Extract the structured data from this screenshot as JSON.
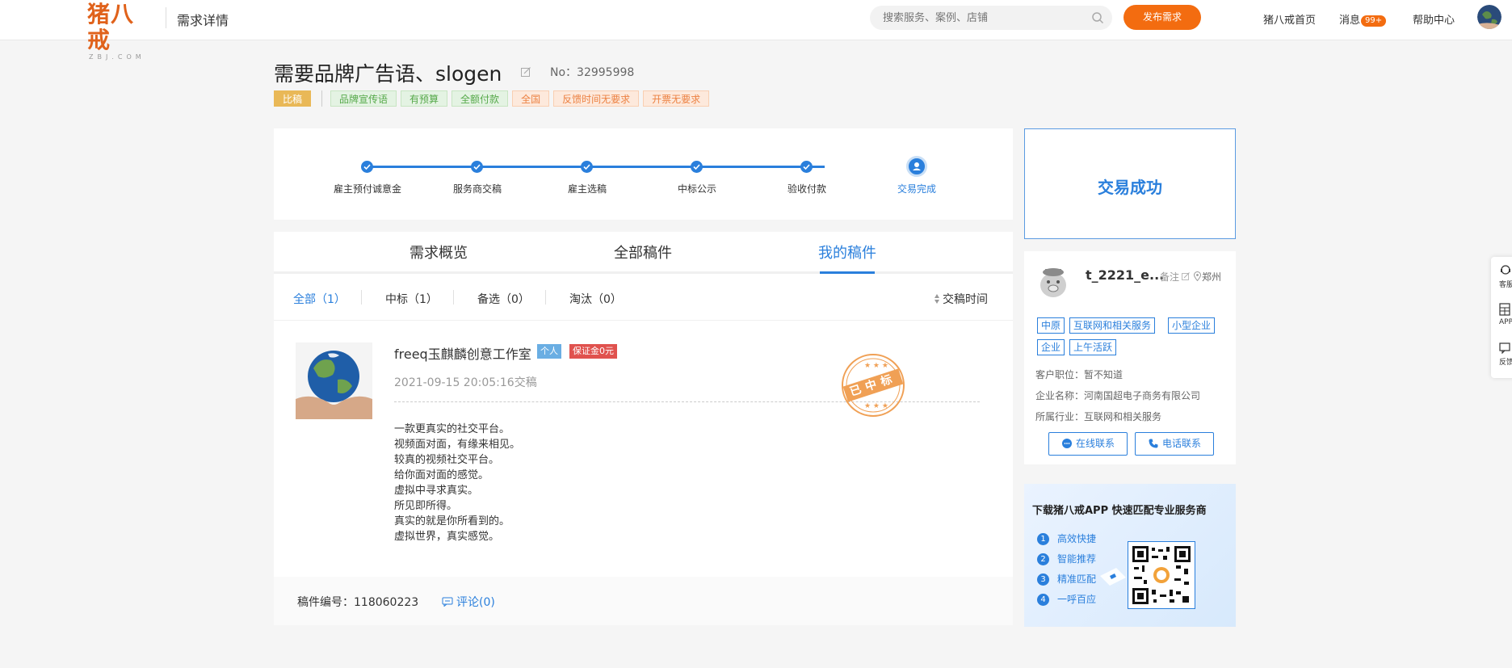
{
  "header": {
    "logo_text": "猪八戒",
    "logo_sub": "ZBJ.COM",
    "page_name": "需求详情",
    "search_placeholder": "搜索服务、案例、店铺",
    "publish_label": "发布需求",
    "nav": {
      "home": "猪八戒首页",
      "messages": "消息",
      "messages_badge": "99+",
      "help": "帮助中心"
    }
  },
  "requirement": {
    "title": "需要品牌广告语、slogen",
    "number": "No：32995998",
    "type_tag": "比稿",
    "tags_green": [
      "品牌宣传语",
      "有预算",
      "全额付款"
    ],
    "tags_orange": [
      "全国",
      "反馈时间无要求",
      "开票无要求"
    ]
  },
  "progress": {
    "steps": [
      "雇主预付诚意金",
      "服务商交稿",
      "雇主选稿",
      "中标公示",
      "验收付款",
      "交易完成"
    ],
    "current_index": 5
  },
  "tabs": {
    "items": [
      "需求概览",
      "全部稿件",
      "我的稿件"
    ],
    "active": "我的稿件"
  },
  "filters": {
    "all": "全部（1）",
    "won": "中标（1）",
    "backup": "备选（0）",
    "eliminated": "淘汰（0）",
    "sort": "交稿时间"
  },
  "work": {
    "provider_name": "freeq玉麒麟创意工作室",
    "badge_person": "个人",
    "badge_deposit": "保证金0元",
    "submitted_at": "2021-09-15 20:05:16交稿",
    "stamp_text": "已中标",
    "content_lines": [
      "一款更真实的社交平台。",
      "视频面对面，有缘来相见。",
      "较真的视频社交平台。",
      "给你面对面的感觉。",
      "虚拟中寻求真实。",
      "所见即所得。",
      "真实的就是你所看到的。",
      "虚拟世界，真实感觉。"
    ],
    "code": "稿件编号：118060223",
    "comment": "评论(0)"
  },
  "status": {
    "text": "交易成功"
  },
  "employer": {
    "name": "t_2221_e...",
    "note": "备注",
    "location": "郑州",
    "tags": [
      "中原",
      "互联网和相关服务",
      "小型企业",
      "企业",
      "上午活跃"
    ],
    "position": "客户职位：暂不知道",
    "company": "企业名称：河南国超电子商务有限公司",
    "industry": "所属行业：互联网和相关服务",
    "online_contact": "在线联系",
    "phone_contact": "电话联系"
  },
  "app_promo": {
    "title": "下载猪八戒APP 快速匹配专业服务商",
    "features": [
      "高效快捷",
      "智能推荐",
      "精准匹配",
      "一呼百应"
    ]
  },
  "float_bar": {
    "service": "客服",
    "app": "APP",
    "feedback": "反馈"
  },
  "colors": {
    "accent": "#2a7fdc",
    "brand_orange": "#f36c10",
    "stamp": "#f0a055"
  }
}
